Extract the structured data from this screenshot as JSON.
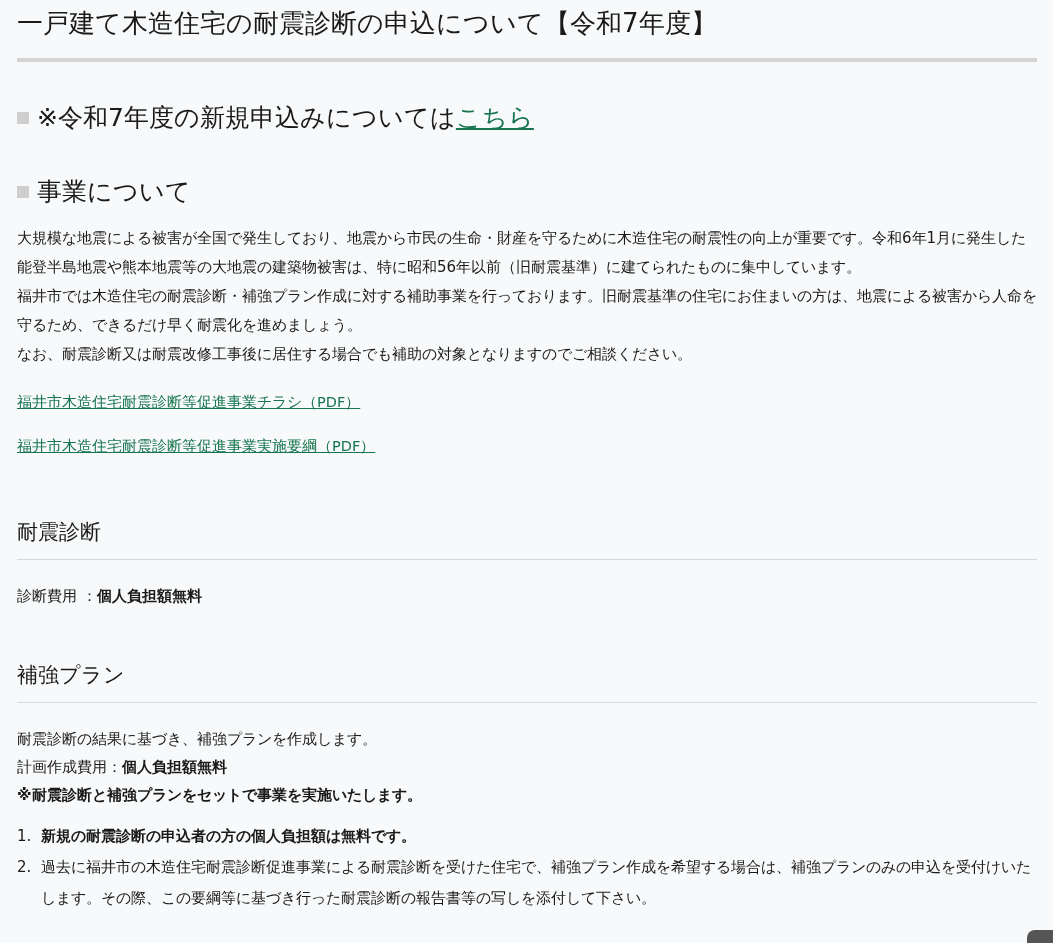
{
  "title": "一戸建て木造住宅の耐震診断の申込について【令和7年度】",
  "notice": {
    "text": "※令和7年度の新規申込みについては",
    "link": "こちら"
  },
  "about": {
    "heading": "事業について",
    "paragraphs": [
      "大規模な地震による被害が全国で発生しており、地震から市民の生命・財産を守るために木造住宅の耐震性の向上が重要です。令和6年1月に発生した能登半島地震や熊本地震等の大地震の建築物被害は、特に昭和56年以前（旧耐震基準）に建てられたものに集中しています。",
      "福井市では木造住宅の耐震診断・補強プラン作成に対する補助事業を行っております。旧耐震基準の住宅にお住まいの方は、地震による被害から人命を守るため、できるだけ早く耐震化を進めましょう。",
      "なお、耐震診断又は耐震改修工事後に居住する場合でも補助の対象となりますのでご相談ください。"
    ],
    "links": [
      "福井市木造住宅耐震診断等促進事業チラシ（PDF）",
      "福井市木造住宅耐震診断等促進事業実施要綱（PDF）"
    ]
  },
  "sections": [
    {
      "heading": "耐震診断",
      "lines": [
        {
          "kind": "plain",
          "text": "診断費用 ：**個人負担額無料**"
        }
      ]
    },
    {
      "heading": "補強プラン",
      "lines": [
        {
          "kind": "plain",
          "text": "耐震診断の結果に基づき、補強プランを作成します。"
        },
        {
          "kind": "plain",
          "text": "計画作成費用：**個人負担額無料**"
        },
        {
          "kind": "emphasis",
          "text": "※耐震診断と補強プランをセットで事業を実施いたします。"
        }
      ],
      "list": [
        {
          "number": "1.",
          "bold": true,
          "text": "新規の耐震診断の申込者の方の個人負担額は無料です。"
        },
        {
          "number": "2.",
          "bold": false,
          "text": "過去に福井市の木造住宅耐震診断促進事業による耐震診断を受けた住宅で、補強プラン作成を希望する場合は、補強プランのみの申込を受付けいたします。その際、この要綱等に基づき行った耐震診断の報告書等の写しを添付して下さい。"
        }
      ]
    }
  ]
}
